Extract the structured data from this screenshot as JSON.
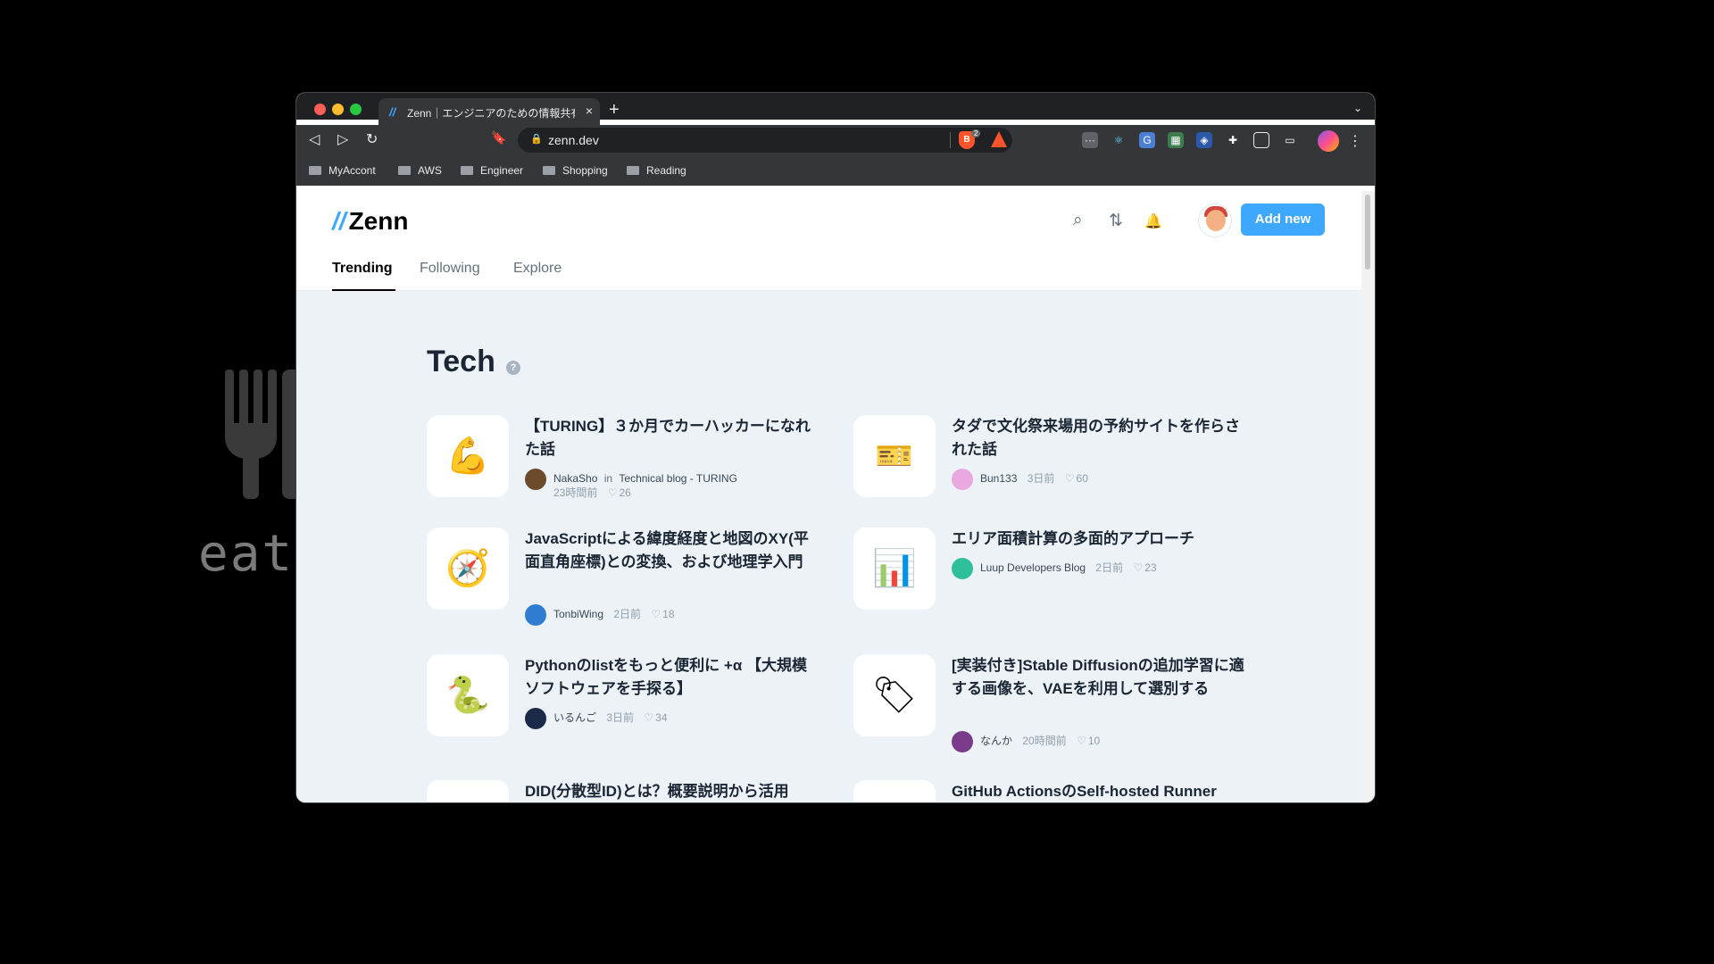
{
  "background": {
    "terminal_text": "eat",
    "terminal_cursor": "("
  },
  "browser": {
    "tab": {
      "favicon": "zenn-logo-icon",
      "title": "Zenn｜エンジニアのための情報共有",
      "close": "×"
    },
    "new_tab": "+",
    "tab_list": "⌄",
    "toolbar": {
      "back": "◁",
      "forward": "▷",
      "reload": "↻",
      "bookmark": "🔖",
      "lock": "🔒",
      "url": "zenn.dev",
      "shield_count": "2",
      "menu": "⋮"
    },
    "bookmarks": [
      {
        "label": "MyAccont"
      },
      {
        "label": "AWS"
      },
      {
        "label": "Engineer"
      },
      {
        "label": "Shopping"
      },
      {
        "label": "Reading"
      }
    ]
  },
  "site": {
    "logo": "Zenn",
    "logo_mark": "//",
    "header": {
      "search": "⌕",
      "pull_request": "⇅",
      "notifications": "🔔",
      "add_new": "Add new"
    },
    "nav": [
      {
        "label": "Trending",
        "active": true
      },
      {
        "label": "Following",
        "active": false
      },
      {
        "label": "Explore",
        "active": false
      }
    ],
    "section_title": "Tech",
    "help": "?",
    "articles": [
      {
        "emoji": "💪",
        "title": "【TURING】３か月でカーハッカーになれた話",
        "author": "NakaSho",
        "publication_in": "in",
        "publication": "Technical blog - TURING",
        "date": "23時間前",
        "likes": "26",
        "avatar_color": "#6b4a2b"
      },
      {
        "emoji": "🎫",
        "title": "タダで文化祭来場用の予約サイトを作らされた話",
        "author": "Bun133",
        "date": "3日前",
        "likes": "60",
        "avatar_color": "#e9a8e0"
      },
      {
        "emoji": "🧭",
        "title": "JavaScriptによる緯度経度と地図のXY(平面直角座標)との変換、および地理学入門",
        "author": "TonbiWing",
        "date": "2日前",
        "likes": "18",
        "avatar_color": "#2f7dd1"
      },
      {
        "emoji": "📊",
        "title": "エリア面積計算の多面的アプローチ",
        "author": "Luup Developers Blog",
        "date": "2日前",
        "likes": "23",
        "avatar_color": "#2fbf9b"
      },
      {
        "emoji": "🐍",
        "title": "Pythonのlistをもっと便利に +α 【大規模ソフトウェアを手探る】",
        "author": "いるんご",
        "date": "3日前",
        "likes": "34",
        "avatar_color": "#1c2a4a"
      },
      {
        "emoji": "🏷",
        "title": "[実装付き]Stable Diffusionの追加学習に適する画像を、VAEを利用して選別する",
        "author": "なんか",
        "date": "20時間前",
        "likes": "10",
        "avatar_color": "#7a3c8a"
      },
      {
        "emoji": "",
        "title": "DID(分散型ID)とは？概要説明から活用",
        "author": "",
        "date": "",
        "likes": ""
      },
      {
        "emoji": "",
        "title": "GitHub ActionsのSelf-hosted Runner",
        "author": "",
        "date": "",
        "likes": ""
      }
    ]
  },
  "colors": {
    "accent": "#3ea8ff",
    "page_bg": "#edf2f7",
    "text_primary": "#1a2634",
    "text_muted": "#65717b"
  }
}
